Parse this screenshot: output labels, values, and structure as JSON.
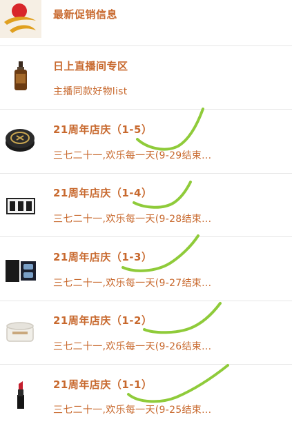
{
  "items": [
    {
      "title": "最新促销信息",
      "subtitle": "",
      "thumb": "company-logo"
    },
    {
      "title": "日上直播间专区",
      "subtitle": "主播同款好物list",
      "thumb": "serum-bottle"
    },
    {
      "title": "21周年店庆（1-5）",
      "subtitle": "三七二十一,欢乐每一天(9-29结束...",
      "thumb": "cushion-compact"
    },
    {
      "title": "21周年店庆（1-4）",
      "subtitle": "三七二十一,欢乐每一天(9-28结束...",
      "thumb": "product-set"
    },
    {
      "title": "21周年店庆（1-3）",
      "subtitle": "三七二十一,欢乐每一天(9-27结束...",
      "thumb": "perfume-gift-box"
    },
    {
      "title": "21周年店庆（1-2）",
      "subtitle": "三七二十一,欢乐每一天(9-26结束...",
      "thumb": "cream-jar"
    },
    {
      "title": "21周年店庆（1-1）",
      "subtitle": "三七二十一,欢乐每一天(9-25结束...",
      "thumb": "lipstick"
    }
  ],
  "colors": {
    "text_accent": "#c8692e",
    "check_mark": "#8fcb3a",
    "divider": "#e6e6e6"
  }
}
